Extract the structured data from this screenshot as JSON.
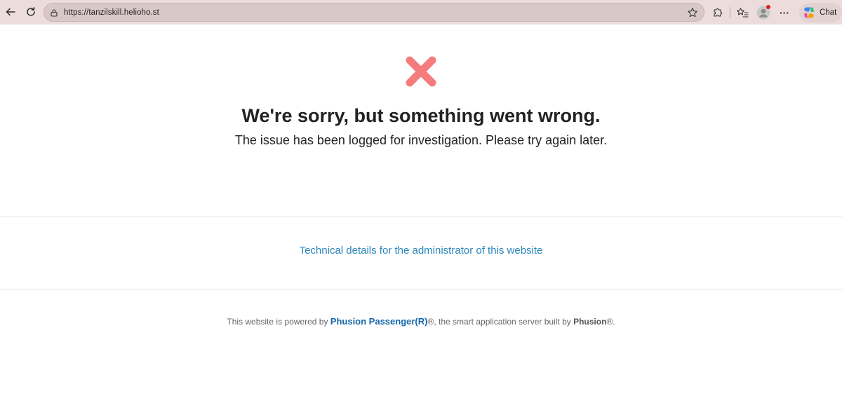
{
  "browser": {
    "url": "https://tanzilskill.helioho.st",
    "chat_label": "Chat",
    "more_label": "···"
  },
  "error": {
    "headline": "We're sorry, but something went wrong.",
    "message": "The issue has been logged for investigation. Please try again later.",
    "icon": "x-mark-icon",
    "icon_color": "#f47c7c"
  },
  "details_link": "Technical details for the administrator of this website",
  "footer": {
    "prefix": "This website is powered by ",
    "passenger": "Phusion Passenger(R)",
    "middle": "®, the smart application server built by ",
    "phusion": "Phusion",
    "suffix": "®."
  },
  "colors": {
    "link": "#2a86bb",
    "toolbar": "#ecdcdc"
  }
}
